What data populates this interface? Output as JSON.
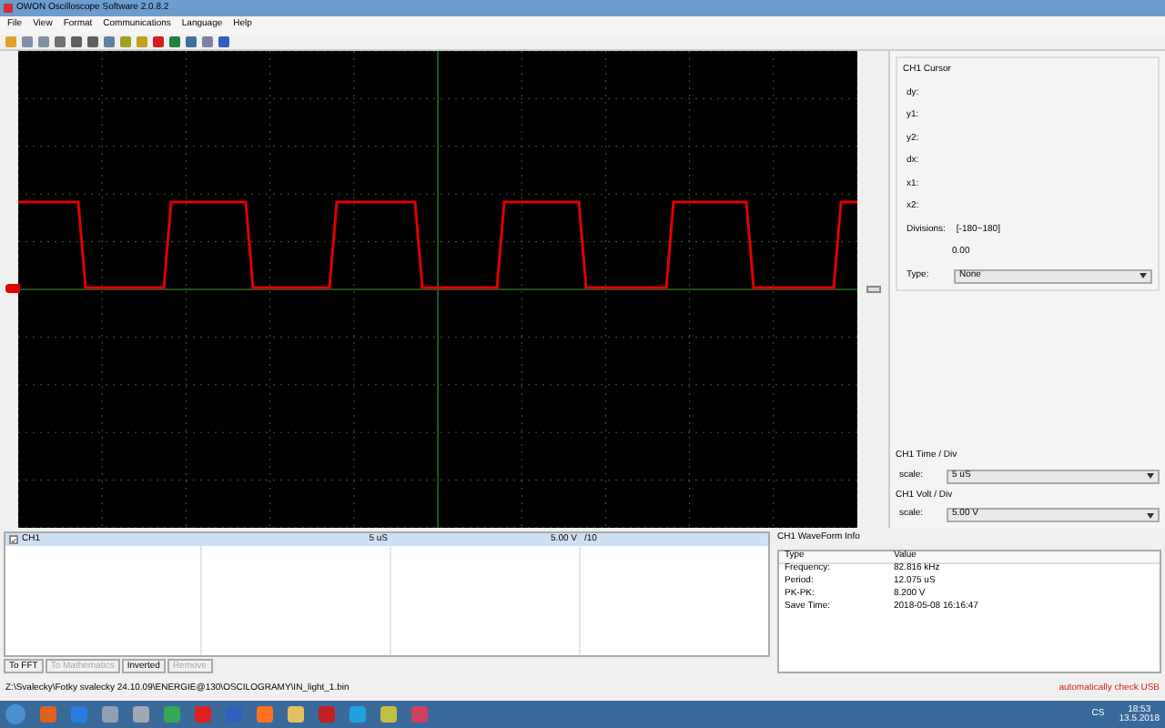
{
  "window": {
    "title": "OWON Oscilloscope Software 2.0.8.2"
  },
  "menu": [
    "File",
    "View",
    "Format",
    "Communications",
    "Language",
    "Help"
  ],
  "cursor_panel": {
    "title": "CH1 Cursor",
    "fields": [
      "dy:",
      "y1:",
      "y2:",
      "dx:",
      "x1:",
      "x2:"
    ],
    "divisions_label": "Divisions:",
    "divisions_range": "[-180~180]",
    "divisions_value": "0.00",
    "type_label": "Type:",
    "type_value": "None"
  },
  "time_div": {
    "title": "CH1 Time / Div",
    "scale_label": "scale:",
    "scale_value": "5  uS"
  },
  "volt_div": {
    "title": "CH1 Volt / Div",
    "scale_label": "scale:",
    "scale_value": "5.00 V"
  },
  "channels": [
    {
      "name": "CH1",
      "checked": true,
      "selected": true,
      "time": "5  uS",
      "volt": "5.00 V",
      "probe": "/10"
    }
  ],
  "buttons": [
    {
      "label": "To FFT",
      "disabled": false
    },
    {
      "label": "To Mathematics",
      "disabled": true
    },
    {
      "label": "Inverted",
      "disabled": false
    },
    {
      "label": "Remove",
      "disabled": true
    }
  ],
  "waveform_info": {
    "title": "CH1 WaveForm Info",
    "columns": [
      "Type",
      "Value"
    ],
    "rows": [
      [
        "Frequency:",
        "82.816 kHz"
      ],
      [
        "Period:",
        "12.075 uS"
      ],
      [
        "PK-PK:",
        "8.200 V"
      ],
      [
        "Save Time:",
        "2018-05-08 16:16:47"
      ]
    ]
  },
  "status_bar": {
    "path": "Z:\\Svaleckу\\Fotky svalecky 24.10.09\\ENERGIE@130\\OSCILOGRAMY\\IN_light_1.bin",
    "usb_status": "automatically check USB"
  },
  "taskbar": {
    "language": "CS",
    "time": "18:53",
    "date": "13.5.2018"
  }
}
